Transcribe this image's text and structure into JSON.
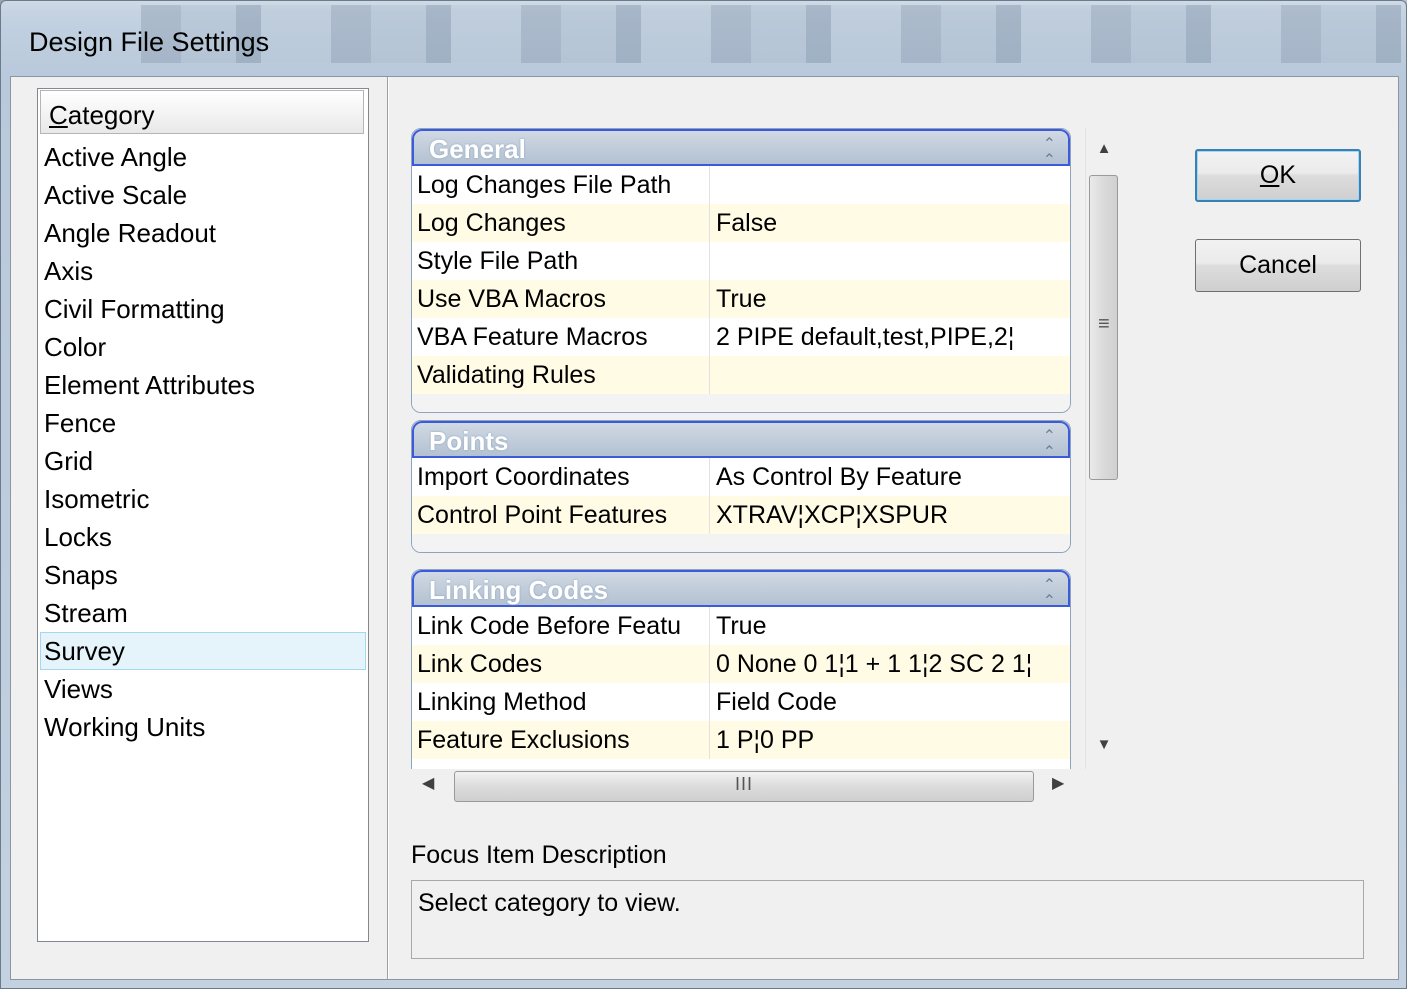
{
  "window": {
    "title": "Design File Settings"
  },
  "category": {
    "header": "Category",
    "header_mnemonic": "C",
    "header_rest": "ategory",
    "items": [
      "Active Angle",
      "Active Scale",
      "Angle Readout",
      "Axis",
      "Civil Formatting",
      "Color",
      "Element Attributes",
      "Fence",
      "Grid",
      "Isometric",
      "Locks",
      "Snaps",
      "Stream",
      "Survey",
      "Views",
      "Working Units"
    ],
    "selected": "Survey"
  },
  "groups": {
    "general": {
      "title": "General",
      "rows": [
        {
          "key": "Log Changes File Path",
          "value": ""
        },
        {
          "key": "Log Changes",
          "value": "False"
        },
        {
          "key": "Style File Path",
          "value": ""
        },
        {
          "key": "Use VBA Macros",
          "value": "True"
        },
        {
          "key": "VBA Feature Macros",
          "value": "2 PIPE default,test,PIPE,2¦"
        },
        {
          "key": "Validating Rules",
          "value": ""
        }
      ]
    },
    "points": {
      "title": "Points",
      "rows": [
        {
          "key": "Import Coordinates",
          "value": "As Control By Feature"
        },
        {
          "key": "Control Point Features",
          "value": "XTRAV¦XCP¦XSPUR"
        }
      ]
    },
    "linking": {
      "title": "Linking Codes",
      "rows": [
        {
          "key": "Link Code Before Featu",
          "value": "True"
        },
        {
          "key": "Link Codes",
          "value": "0 None 0 1¦1 + 1 1¦2 SC 2 1¦"
        },
        {
          "key": "Linking Method",
          "value": "Field Code"
        },
        {
          "key": "Feature  Exclusions",
          "value": "1 P¦0 PP"
        }
      ]
    }
  },
  "buttons": {
    "ok_mnemonic": "O",
    "ok_rest": "K",
    "cancel": "Cancel"
  },
  "description": {
    "label": "Focus Item Description",
    "text": "Select category to view."
  },
  "icons": {
    "collapse": "collapse-chevron-icon",
    "scroll_up": "arrow-up-icon",
    "scroll_down": "arrow-down-icon",
    "scroll_left": "arrow-left-icon",
    "scroll_right": "arrow-right-icon"
  },
  "colors": {
    "group_header_border": "#3b5bdb",
    "alt_row": "#fffbe5",
    "selected_item": "#e5f3fb"
  }
}
